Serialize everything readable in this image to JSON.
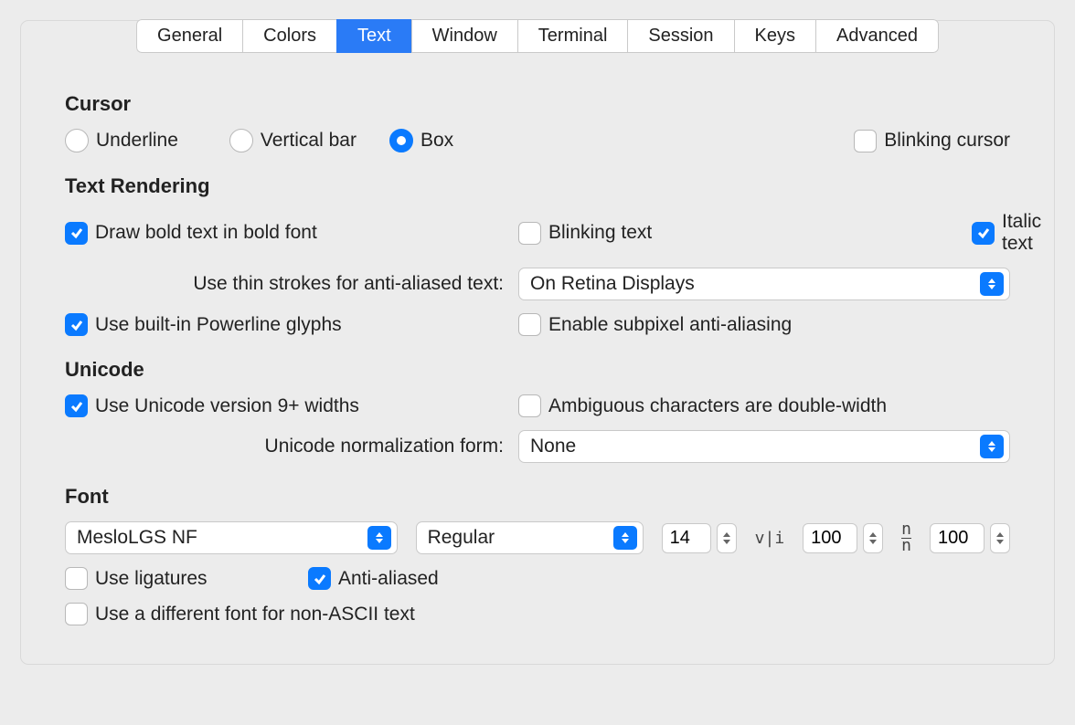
{
  "tabs": {
    "items": [
      "General",
      "Colors",
      "Text",
      "Window",
      "Terminal",
      "Session",
      "Keys",
      "Advanced"
    ],
    "active": "Text"
  },
  "cursor": {
    "title": "Cursor",
    "radios": {
      "underline": "Underline",
      "vbar": "Vertical bar",
      "box": "Box"
    },
    "blinking_label": "Blinking cursor"
  },
  "render": {
    "title": "Text Rendering",
    "bold_bold": "Draw bold text in bold font",
    "blinking_text": "Blinking text",
    "italic_text": "Italic text",
    "thin_strokes_label": "Use thin strokes for anti-aliased text:",
    "thin_strokes_value": "On Retina Displays",
    "powerline": "Use built-in Powerline glyphs",
    "subpixel": "Enable subpixel anti-aliasing"
  },
  "unicode": {
    "title": "Unicode",
    "v9widths": "Use Unicode version 9+ widths",
    "ambiguous": "Ambiguous characters are double-width",
    "norm_label": "Unicode normalization form:",
    "norm_value": "None"
  },
  "font": {
    "title": "Font",
    "family": "MesloLGS NF",
    "weight": "Regular",
    "size": "14",
    "hspacing_glyph": "v|i",
    "hspacing": "100",
    "vspacing_glyph": "n̲n",
    "vspacing": "100",
    "ligatures": "Use ligatures",
    "antialiased": "Anti-aliased",
    "nonascii": "Use a different font for non-ASCII text"
  }
}
